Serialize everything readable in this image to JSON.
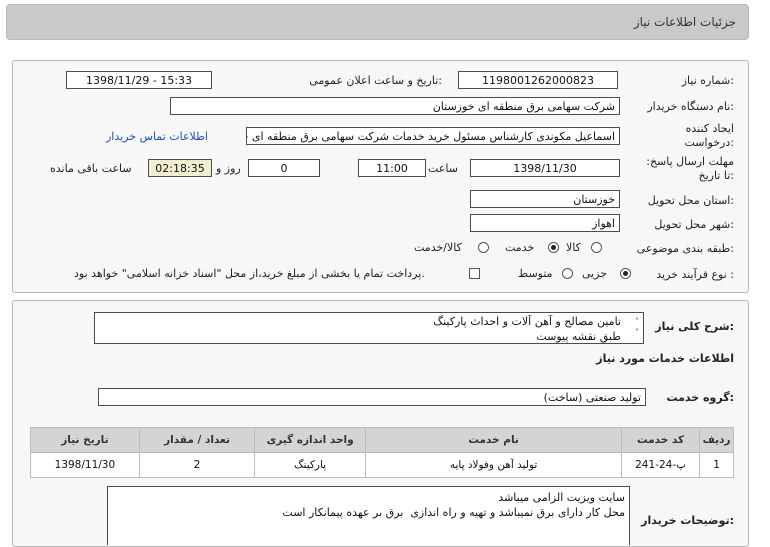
{
  "window_title": "جزئیات اطلاعات نیاز",
  "fields": {
    "need_number_label": "شماره نیاز:",
    "need_number": "1198001262000823",
    "announce_label": "تاریخ و ساعت اعلان عمومی:",
    "announce_value": "1398/11/29 - 15:33",
    "buyer_org_label": "نام دستگاه خریدار:",
    "buyer_org": "شرکت سهامی برق منطقه ای خوزستان",
    "creator_label": "ایجاد کننده درخواست:",
    "creator": "اسماعیل مکوندی کارشناس مسئول خرید خدمات شرکت سهامی برق منطقه ای خوزستان",
    "contact_link": "اطلاعات تماس خریدار",
    "deadline_label": "مهلت ارسال پاسخ: تا تاریخ:",
    "deadline_date": "1398/11/30",
    "time_label": "ساعت",
    "deadline_time": "11:00",
    "days_value": "0",
    "days_label": "روز و",
    "remaining_time": "02:18:35",
    "remaining_label": "ساعت باقی مانده",
    "province_label": "استان محل تحویل:",
    "province": "خوزستان",
    "city_label": "شهر محل تحویل:",
    "city": "اهواز",
    "category_label": "طبقه بندی موضوعی:",
    "category_options": [
      "کالا",
      "خدمت",
      "کالا/خدمت"
    ],
    "category_selected": "خدمت",
    "process_label": "نوع فرآیند خرید :",
    "process_options": [
      "جزیی",
      "متوسط"
    ],
    "process_selected": "جزیی",
    "payment_note": "پرداخت تمام یا بخشی از مبلغ خرید،از محل \"اسناد خزانه اسلامی\" خواهد بود."
  },
  "description": {
    "label": "شرح کلی نیاز:",
    "line1": "تامین مصالح و آهن آلات و احداث پارکینگ",
    "line2": "طبق نقشه پیوست"
  },
  "services": {
    "section_title": "اطلاعات خدمات مورد نیاز",
    "group_label": "گروه خدمت:",
    "group_value": "تولید صنعتی (ساخت)",
    "columns": [
      "ردیف",
      "کد خدمت",
      "نام خدمت",
      "واحد اندازه گیری",
      "تعداد / مقدار",
      "تاریخ نیاز"
    ],
    "rows": [
      [
        "1",
        "پ-24-241",
        "تولید آهن وفولاد پایه",
        "پارکینگ",
        "2",
        "1398/11/30"
      ]
    ]
  },
  "buyer_notes": {
    "label": "توضیحات خریدار:",
    "line1": "سایت ویزیت الزامی میباشد",
    "line2": "محل کار دارای برق نمیباشد و تهیه و راه اندازی  برق بر عهده پیمانکار است"
  },
  "icons": {
    "scroll": "scroll-arrows-icon"
  }
}
